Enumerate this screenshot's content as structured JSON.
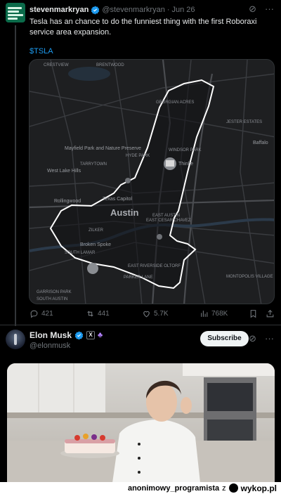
{
  "post1": {
    "author_name": "stevenmarkryan",
    "author_handle": "@stevenmarkryan",
    "separator": "·",
    "date": "Jun 26",
    "avatar_icon": "solving-the-money-problem-logo",
    "text": "Tesla has an chance to do the funniest thing with the first Roboraxi service area expansion.",
    "cashtag": "$TSLA",
    "map_labels": {
      "austin": "Austin",
      "crestview": "CRESTVIEW",
      "brentwood": "BRENTWOOD",
      "georgian_acres": "GEORGIAN ACRES",
      "windsor_park": "WINDSOR PARK",
      "hyde_park": "HYDE PARK",
      "mayfield": "Mayfield Park and Nature Preserve",
      "tarrytown": "TARRYTOWN",
      "west_lake_hills": "West Lake Hills",
      "rollingwood": "Rollingwood",
      "capitol": "Texas Capitol",
      "east_austin": "EAST AUSTIN",
      "east_cesar_chavez": "EAST CESAR CHAVEZ",
      "zilker": "ZILKER",
      "broken_spoke": "Broken Spoke",
      "south_lamar": "SOUTH LAMAR",
      "east_riverside": "EAST RIVERSIDE OLTORF",
      "parker_lane": "PARKER LANE",
      "garrison_park": "GARRISON PARK",
      "south_austin": "SOUTH AUSTIN",
      "buffalo": "Baffalo",
      "thinkery": "Thinke",
      "jester_estates": "JESTER ESTATES",
      "montopolis": "MONTOPOLIS VILLAGE"
    },
    "actions": {
      "replies": "421",
      "reposts": "441",
      "likes": "5.7K",
      "views": "768K"
    },
    "colors": {
      "service_area": "#ffffff",
      "map_bg": "#1e1f21",
      "link": "#1d9bf0"
    }
  },
  "post2": {
    "author_name": "Elon Musk",
    "author_handle": "@elonmusk",
    "x_badge": "X",
    "affiliate_icon": "affiliate-icon",
    "subscribe_label": "Subscribe",
    "photo_alt": "chef-kiss-photo"
  },
  "footer": {
    "username": "anonimowy_programista",
    "suffix": "z",
    "site": "wykop.pl"
  }
}
